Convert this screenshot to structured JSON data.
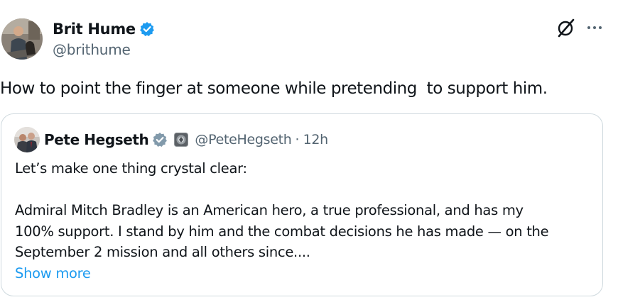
{
  "post": {
    "author": {
      "name": "Brit Hume",
      "handle": "@brithume",
      "verified_color": "#1d9bf0"
    },
    "text": "How to point the finger at someone while pretending  to support him.",
    "actions": {
      "grok_icon": "grok-icon",
      "more_icon": "more-options-icon"
    }
  },
  "quote": {
    "author": {
      "name": "Pete Hegseth",
      "handle": "@PeteHegseth",
      "verified_color": "#829aab",
      "badge_icon": "affiliate-badge-icon"
    },
    "separator": "·",
    "time": "12h",
    "lines": [
      "Let’s make one thing crystal clear:",
      "Admiral Mitch Bradley is an American hero, a true professional, and has my",
      "100% support. I stand by him and the combat decisions he has made — on the",
      "September 2 mission and all others since...."
    ],
    "show_more": "Show more"
  },
  "colors": {
    "text": "#0f1419",
    "secondary": "#536471",
    "link": "#1d9bf0",
    "border": "#cfd9de"
  }
}
